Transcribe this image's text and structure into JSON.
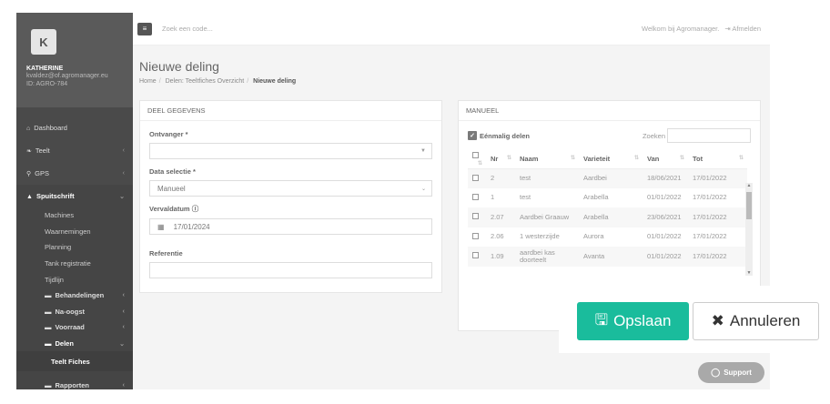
{
  "sidebar": {
    "avatar_letter": "K",
    "user_name": "KATHERINE",
    "email": "kvaldez@of.agromanager.eu",
    "id_label": "ID: AGRO-784",
    "items": [
      {
        "label": "Dashboard",
        "icon": "home-icon"
      },
      {
        "label": "Teelt",
        "icon": "leaf-icon"
      },
      {
        "label": "GPS",
        "icon": "map-marker-icon"
      },
      {
        "label": "Spuitschrift",
        "icon": "spray-icon"
      }
    ],
    "spuitschrift_sub": [
      "Machines",
      "Waarnemingen",
      "Planning",
      "Tank registratie",
      "Tijdlijn"
    ],
    "groups": [
      "Behandelingen",
      "Na-oogst",
      "Voorraad",
      "Delen"
    ],
    "delen_sub": "Teelt Fiches",
    "rapporten": "Rapporten"
  },
  "topbar": {
    "search_placeholder": "Zoek een code...",
    "welcome": "Welkom bij Agromanager.",
    "logout": "Afmelden"
  },
  "page": {
    "title": "Nieuwe deling",
    "breadcrumb": [
      "Home",
      "Delen: Teeltfiches Overzicht",
      "Nieuwe deling"
    ]
  },
  "form": {
    "panel_title": "DEEL GEGEVENS",
    "ontvanger_label": "Ontvanger *",
    "ontvanger_value": "",
    "data_selectie_label": "Data selectie *",
    "data_selectie_value": "Manueel",
    "vervaldatum_label": "Vervaldatum",
    "vervaldatum_value": "17/01/2024",
    "referentie_label": "Referentie",
    "referentie_value": ""
  },
  "manueel": {
    "panel_title": "MANUEEL",
    "eenmalig_label": "Eénmalig delen",
    "zoeken_label": "Zoeken",
    "columns": [
      "Nr",
      "Naam",
      "Varieteit",
      "Van",
      "Tot"
    ],
    "rows": [
      {
        "nr": "2",
        "naam": "test",
        "varieteit": "Aardbei",
        "van": "18/06/2021",
        "tot": "17/01/2022"
      },
      {
        "nr": "1",
        "naam": "test",
        "varieteit": "Arabella",
        "van": "01/01/2022",
        "tot": "17/01/2022"
      },
      {
        "nr": "2.07",
        "naam": "Aardbei Graauw",
        "varieteit": "Arabella",
        "van": "23/06/2021",
        "tot": "17/01/2022"
      },
      {
        "nr": "2.06",
        "naam": "1 westerzijde",
        "varieteit": "Aurora",
        "van": "01/01/2022",
        "tot": "17/01/2022"
      },
      {
        "nr": "1.09",
        "naam": "aardbei kas doorteelt",
        "varieteit": "Avanta",
        "van": "01/01/2022",
        "tot": "17/01/2022"
      }
    ]
  },
  "actions": {
    "save": "Opslaan",
    "cancel": "Annuleren",
    "support": "Support"
  },
  "colors": {
    "save_green": "#1abc9c",
    "sidebar": "#4a4a4a"
  }
}
